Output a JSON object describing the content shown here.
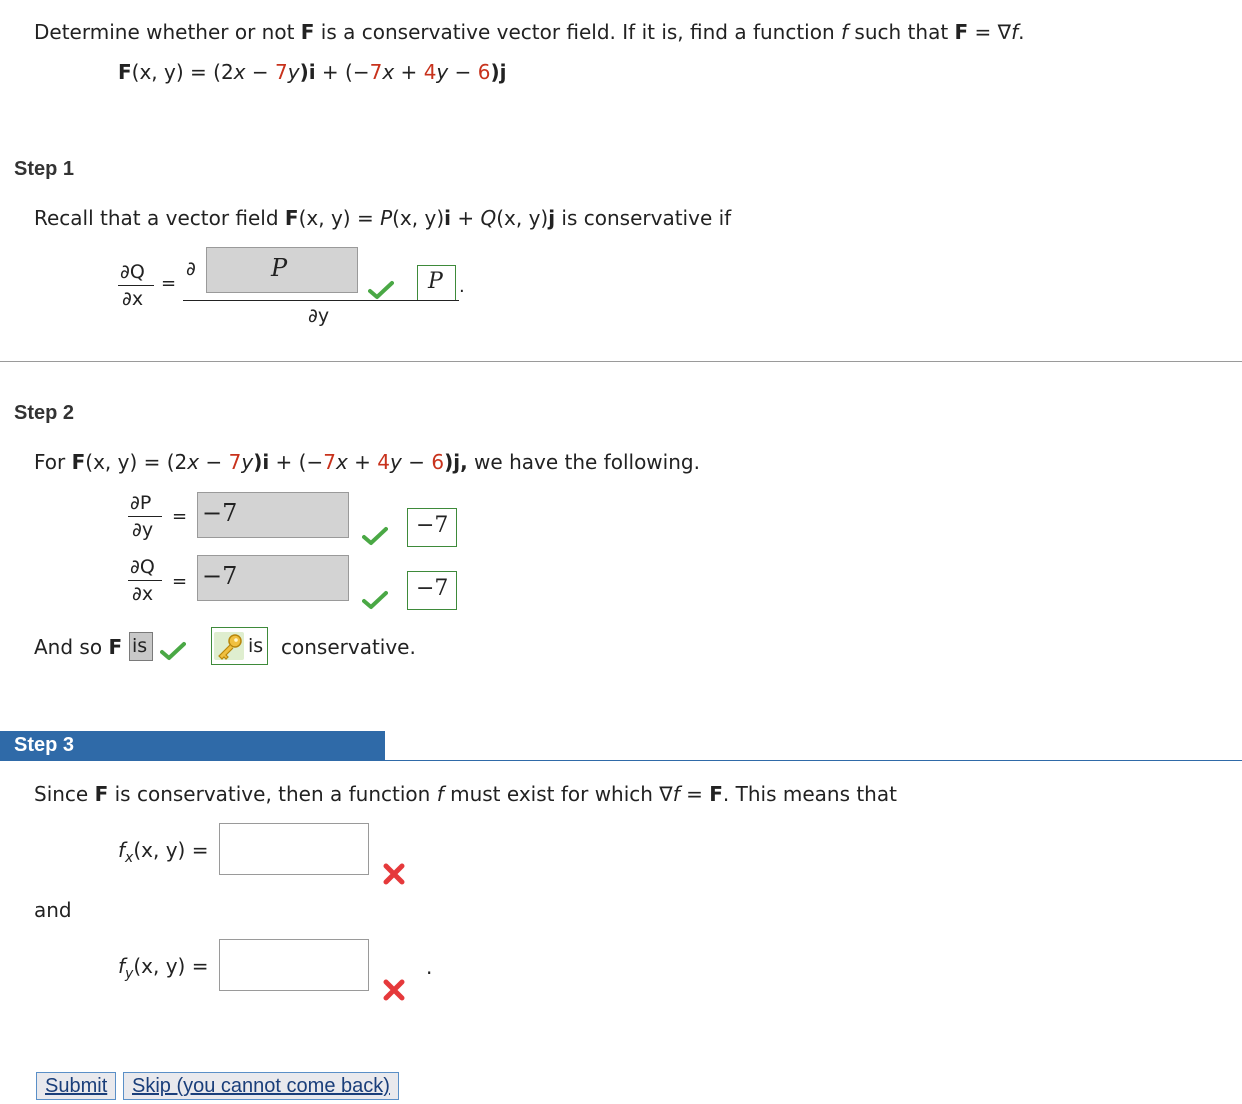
{
  "problem": {
    "prompt_pre": "Determine whether or not ",
    "prompt_F": "F",
    "prompt_mid": " is a conservative vector field. If it is, find a function ",
    "prompt_f": "f",
    "prompt_post1": " such that ",
    "prompt_F2": "F",
    "prompt_post2": " = ∇",
    "prompt_f2": "f",
    "prompt_end": ".",
    "field_lhs": "F",
    "field_xy": "(x, y) = (2",
    "field_x1": "x",
    "field_minus": " − ",
    "field_7y": "7",
    "field_y1": "y",
    "field_i": ")i",
    "field_plus": " + (−",
    "field_7x": "7",
    "field_x2": "x",
    "field_plus2": " + ",
    "field_4y": "4",
    "field_y2": "y",
    "field_minus2": " − ",
    "field_6": "6",
    "field_j": ")j"
  },
  "step1": {
    "label": "Step 1",
    "recall_pre": "Recall that a vector field  ",
    "recall_F": "F",
    "recall_xy": "(x, y) = ",
    "recall_P": "P",
    "recall_xy2": "(x, y)",
    "recall_i": "i",
    "recall_plus": " + ",
    "recall_Q": "Q",
    "recall_xy3": "(x, y)",
    "recall_j": "j",
    "recall_post": "  is conservative if",
    "dQ": "∂Q",
    "dx": "∂x",
    "eq": "=",
    "partial": "∂",
    "input_value": "P",
    "dy": "∂y",
    "answer": "P",
    "period": "."
  },
  "step2": {
    "label": "Step 2",
    "for_text": "For  ",
    "F": "F",
    "xy": "(x, y) = (2",
    "x1": "x",
    "minus": " − ",
    "n7y": "7",
    "y1": "y",
    "i": ")i",
    "plus": " + (−",
    "n7x": "7",
    "x2": "x",
    "plus2": " + ",
    "n4y": "4",
    "y2": "y",
    "minus2": " − ",
    "n6": "6",
    "j": ")j,",
    "have": "  we have the following.",
    "dP": "∂P",
    "dy": "∂y",
    "dQ": "∂Q",
    "dx": "∂x",
    "eq": "=",
    "dPdy_input": "−7",
    "dPdy_answer": "−7",
    "dQdx_input": "−7",
    "dQdx_answer": "−7",
    "andso": "And so ",
    "andso_F": "F",
    "select_value": "is",
    "key_answer": "is",
    "conservative": "conservative."
  },
  "step3": {
    "label": "Step 3",
    "since_pre": "Since ",
    "since_F": "F",
    "since_mid": " is conservative, then a function ",
    "since_f": "f",
    "since_must": " must exist for which  ∇",
    "since_f2": "f",
    "since_eq": " = ",
    "since_F2": "F",
    "since_post": ".  This means that",
    "fx_f": "f",
    "fx_sub": "x",
    "fx_xy": "(x, y)",
    "fx_eq": " =",
    "fx_value": "",
    "and": "and",
    "fy_f": "f",
    "fy_sub": "y",
    "fy_xy": "(x, y)",
    "fy_eq": " =",
    "fy_value": "",
    "period": "."
  },
  "buttons": {
    "submit": "Submit",
    "skip": "Skip (you cannot come back)"
  },
  "colors": {
    "accent_red": "#c8321c",
    "step3_bar": "#2f6aa8",
    "check_green": "#4aa845",
    "x_red": "#e5393b"
  }
}
